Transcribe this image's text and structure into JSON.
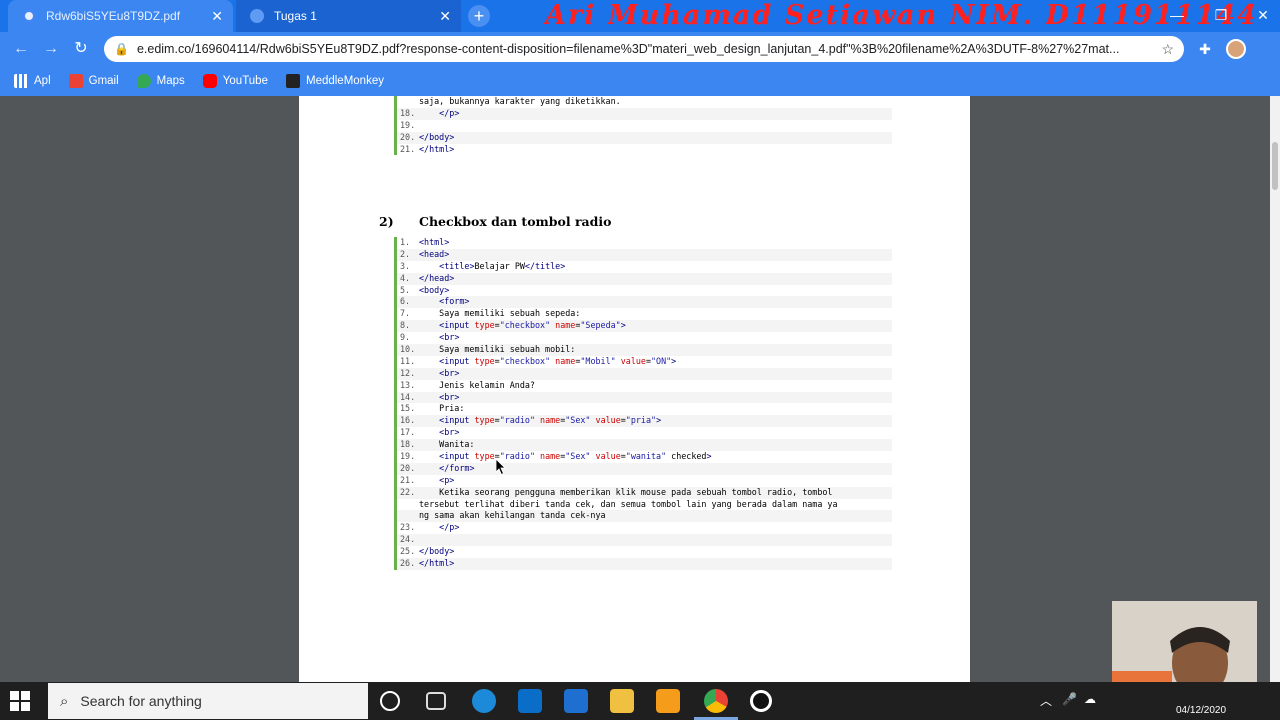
{
  "browser": {
    "tabs": [
      {
        "title": "Rdw6biS5YEu8T9DZ.pdf",
        "active": true
      },
      {
        "title": "Tugas 1",
        "active": false
      }
    ],
    "overlay_text": "Ari Muhamad Setiawan NIM. D111911144",
    "url": "e.edim.co/169604114/Rdw6biS5YEu8T9DZ.pdf?response-content-disposition=filename%3D\"materi_web_design_lanjutan_4.pdf\"%3B%20filename%2A%3DUTF-8%27%27mat...",
    "bookmarks": [
      "Apl",
      "Gmail",
      "Maps",
      "YouTube",
      "MeddleMonkey"
    ]
  },
  "document": {
    "top_code": [
      {
        "ln": "",
        "text": "saja, bukannya karakter yang diketikkan."
      },
      {
        "ln": "18.",
        "text": "    </p>"
      },
      {
        "ln": "19.",
        "text": ""
      },
      {
        "ln": "20.",
        "text": "</body>"
      },
      {
        "ln": "21.",
        "text": "</html>"
      }
    ],
    "section_number": "2)",
    "section_title": "Checkbox dan tombol radio",
    "code": [
      {
        "ln": "1.",
        "text": "<html>"
      },
      {
        "ln": "2.",
        "text": "<head>"
      },
      {
        "ln": "3.",
        "text": "    <title>Belajar PW</title>"
      },
      {
        "ln": "4.",
        "text": "</head>"
      },
      {
        "ln": "5.",
        "text": "<body>"
      },
      {
        "ln": "6.",
        "text": "    <form>"
      },
      {
        "ln": "7.",
        "text": "    Saya memiliki sebuah sepeda:"
      },
      {
        "ln": "8.",
        "text": "    <input type=\"checkbox\" name=\"Sepeda\">"
      },
      {
        "ln": "9.",
        "text": "    <br>"
      },
      {
        "ln": "10.",
        "text": "    Saya memiliki sebuah mobil:"
      },
      {
        "ln": "11.",
        "text": "    <input type=\"checkbox\" name=\"Mobil\" value=\"ON\">"
      },
      {
        "ln": "12.",
        "text": "    <br>"
      },
      {
        "ln": "13.",
        "text": "    Jenis kelamin Anda?"
      },
      {
        "ln": "14.",
        "text": "    <br>"
      },
      {
        "ln": "15.",
        "text": "    Pria:"
      },
      {
        "ln": "16.",
        "text": "    <input type=\"radio\" name=\"Sex\" value=\"pria\">"
      },
      {
        "ln": "17.",
        "text": "    <br>"
      },
      {
        "ln": "18.",
        "text": "    Wanita:"
      },
      {
        "ln": "19.",
        "text": "    <input type=\"radio\" name=\"Sex\" value=\"wanita\" checked>"
      },
      {
        "ln": "20.",
        "text": "    </form>"
      },
      {
        "ln": "21.",
        "text": "    <p>"
      },
      {
        "ln": "22.",
        "text": "    Ketika seorang pengguna memberikan klik mouse pada sebuah tombol radio, tombol"
      },
      {
        "ln": "",
        "text": "tersebut terlihat diberi tanda cek, dan semua tombol lain yang berada dalam nama ya"
      },
      {
        "ln": "",
        "text": "ng sama akan kehilangan tanda cek-nya"
      },
      {
        "ln": "23.",
        "text": "    </p>"
      },
      {
        "ln": "24.",
        "text": ""
      },
      {
        "ln": "25.",
        "text": "</body>"
      },
      {
        "ln": "26.",
        "text": "</html>"
      }
    ]
  },
  "taskbar": {
    "search_placeholder": "Search for anything",
    "date": "04/12/2020"
  },
  "colors": {
    "chrome_blue": "#1a73e8",
    "code_bar_green": "#6ab04c",
    "overlay_red": "#ff2020"
  }
}
